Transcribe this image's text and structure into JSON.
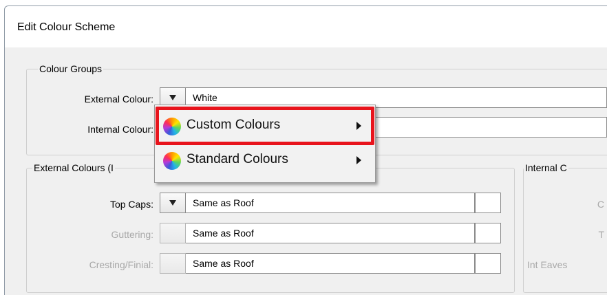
{
  "window": {
    "title": "Edit Colour Scheme"
  },
  "colour_groups": {
    "label": "Colour Groups",
    "external": {
      "label": "External Colour:",
      "value": "White"
    },
    "internal": {
      "label": "Internal Colour:",
      "value": ""
    }
  },
  "external_colours": {
    "label": "External Colours (I",
    "rows": [
      {
        "label": "Top Caps:",
        "value": "Same as Roof",
        "enabled": true
      },
      {
        "label": "Guttering:",
        "value": "Same as Roof",
        "enabled": false
      },
      {
        "label": "Cresting/Finial:",
        "value": "Same as Roof",
        "enabled": false
      }
    ]
  },
  "internal_colours": {
    "label": "Internal C",
    "row_labels": [
      "C",
      "T",
      "Int Eaves"
    ]
  },
  "context_menu": {
    "items": [
      {
        "label": "Custom Colours",
        "icon": "colour-wheel-icon"
      },
      {
        "label": "Standard Colours",
        "icon": "colour-wheel-icon"
      }
    ]
  },
  "colors": {
    "highlight": "#e8141c",
    "disabled_text": "#a8a8a8"
  }
}
